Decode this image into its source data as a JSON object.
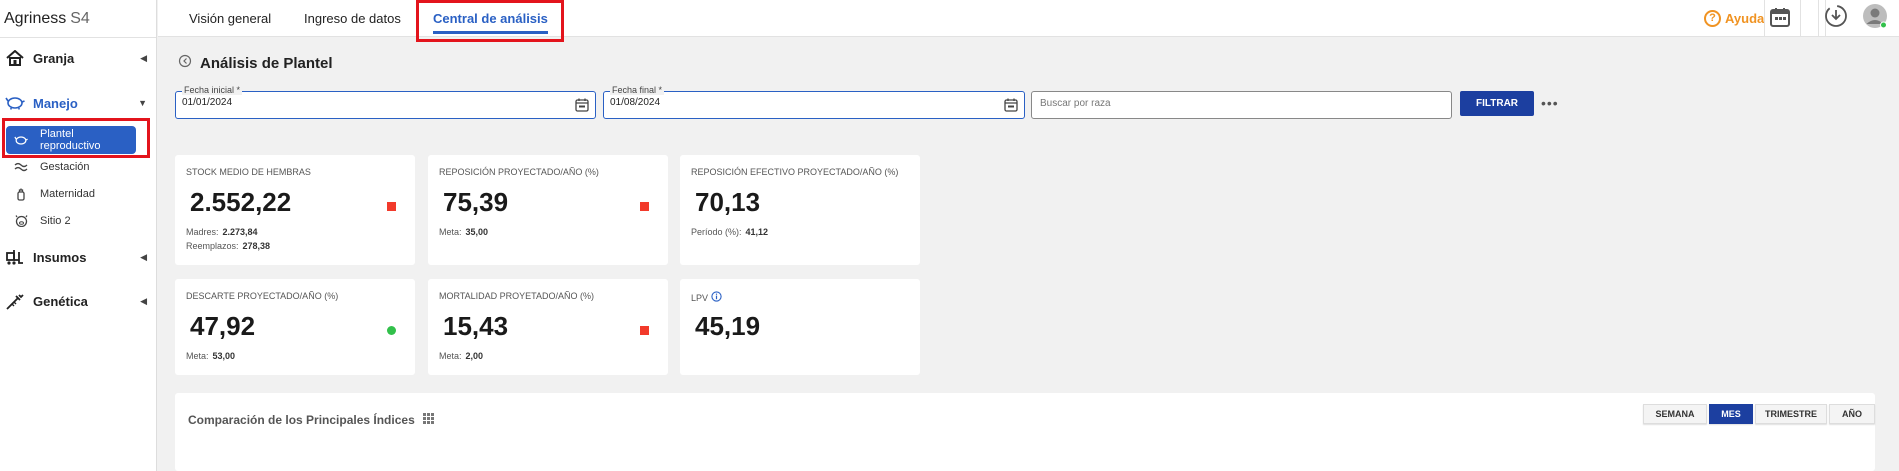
{
  "app": {
    "brand_name": "Agriness",
    "brand_suffix": "S4"
  },
  "sidebar": {
    "sections": [
      {
        "label": "Granja"
      },
      {
        "label": "Manejo"
      },
      {
        "label": "Insumos"
      },
      {
        "label": "Genética"
      }
    ],
    "manejo_items": [
      {
        "label": "Plantel reproductivo"
      },
      {
        "label": "Gestación"
      },
      {
        "label": "Maternidad"
      },
      {
        "label": "Sitio 2"
      }
    ]
  },
  "topbar": {
    "tabs": [
      {
        "label": "Visión general"
      },
      {
        "label": "Ingreso de datos"
      },
      {
        "label": "Central de análisis"
      }
    ],
    "help_label": "Ayuda"
  },
  "page": {
    "title": "Análisis de Plantel"
  },
  "filters": {
    "start_label": "Fecha inicial *",
    "start_value": "01/01/2024",
    "end_label": "Fecha final *",
    "end_value": "01/08/2024",
    "search_placeholder": "Buscar por raza",
    "filter_button": "FILTRAR",
    "more": "•••"
  },
  "cards": [
    {
      "title": "STOCK MEDIO DE HEMBRAS",
      "value": "2.552,22",
      "indicator": "red",
      "subs": [
        {
          "label": "Madres:",
          "value": "2.273,84"
        },
        {
          "label": "Reemplazos:",
          "value": "278,38"
        }
      ]
    },
    {
      "title": "REPOSICIÓN PROYECTADO/AÑO (%)",
      "value": "75,39",
      "indicator": "red",
      "subs": [
        {
          "label": "Meta:",
          "value": "35,00"
        }
      ]
    },
    {
      "title": "REPOSICIÓN EFECTIVO PROYECTADO/AÑO (%)",
      "value": "70,13",
      "indicator": "none",
      "subs": [
        {
          "label": "Período (%):",
          "value": "41,12"
        }
      ]
    },
    {
      "title": "DESCARTE PROYECTADO/AÑO (%)",
      "value": "47,92",
      "indicator": "green",
      "subs": [
        {
          "label": "Meta:",
          "value": "53,00"
        }
      ]
    },
    {
      "title": "MORTALIDAD PROYETADO/AÑO (%)",
      "value": "15,43",
      "indicator": "red",
      "subs": [
        {
          "label": "Meta:",
          "value": "2,00"
        }
      ]
    },
    {
      "title": "LPV",
      "value": "45,19",
      "indicator": "none",
      "subs": []
    }
  ],
  "comparison": {
    "title": "Comparación de los Principales Índices",
    "periods": [
      {
        "label": "SEMANA"
      },
      {
        "label": "MES"
      },
      {
        "label": "TRIMESTRE"
      },
      {
        "label": "AÑO"
      }
    ],
    "active_period": "MES"
  },
  "colors": {
    "accent": "#2a60c4",
    "filter_button": "#1c3fa0",
    "help": "#f09322",
    "indicator_red": "#f23a2b",
    "indicator_green": "#32c04b",
    "highlight_box": "#e3141c"
  }
}
